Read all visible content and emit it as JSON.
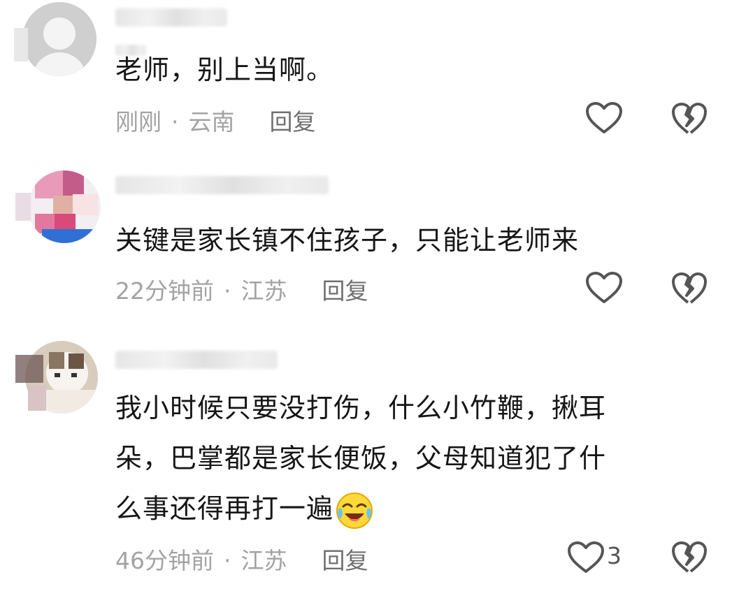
{
  "comments": [
    {
      "text": "老师，别上当啊。",
      "time": "刚刚",
      "location": "云南",
      "reply_label": "回复",
      "like_count": ""
    },
    {
      "text": "关键是家长镇不住孩子，只能让老师来",
      "time": "22分钟前",
      "location": "江苏",
      "reply_label": "回复",
      "like_count": ""
    },
    {
      "text": "我小时候只要没打伤，什么小竹鞭，揪耳\n朵，巴掌都是家长便饭，父母知道犯了什\n么事还得再打一遍",
      "time": "46分钟前",
      "location": "江苏",
      "reply_label": "回复",
      "like_count": "3"
    }
  ],
  "separator": "·",
  "icons": {
    "like": "heart-outline-icon",
    "dislike": "broken-heart-icon",
    "emoji": "crying-laughing-emoji-icon"
  },
  "colors": {
    "text": "#161616",
    "meta": "#a3a3a3",
    "reply": "#6f6f6f",
    "icon": "#555555"
  }
}
